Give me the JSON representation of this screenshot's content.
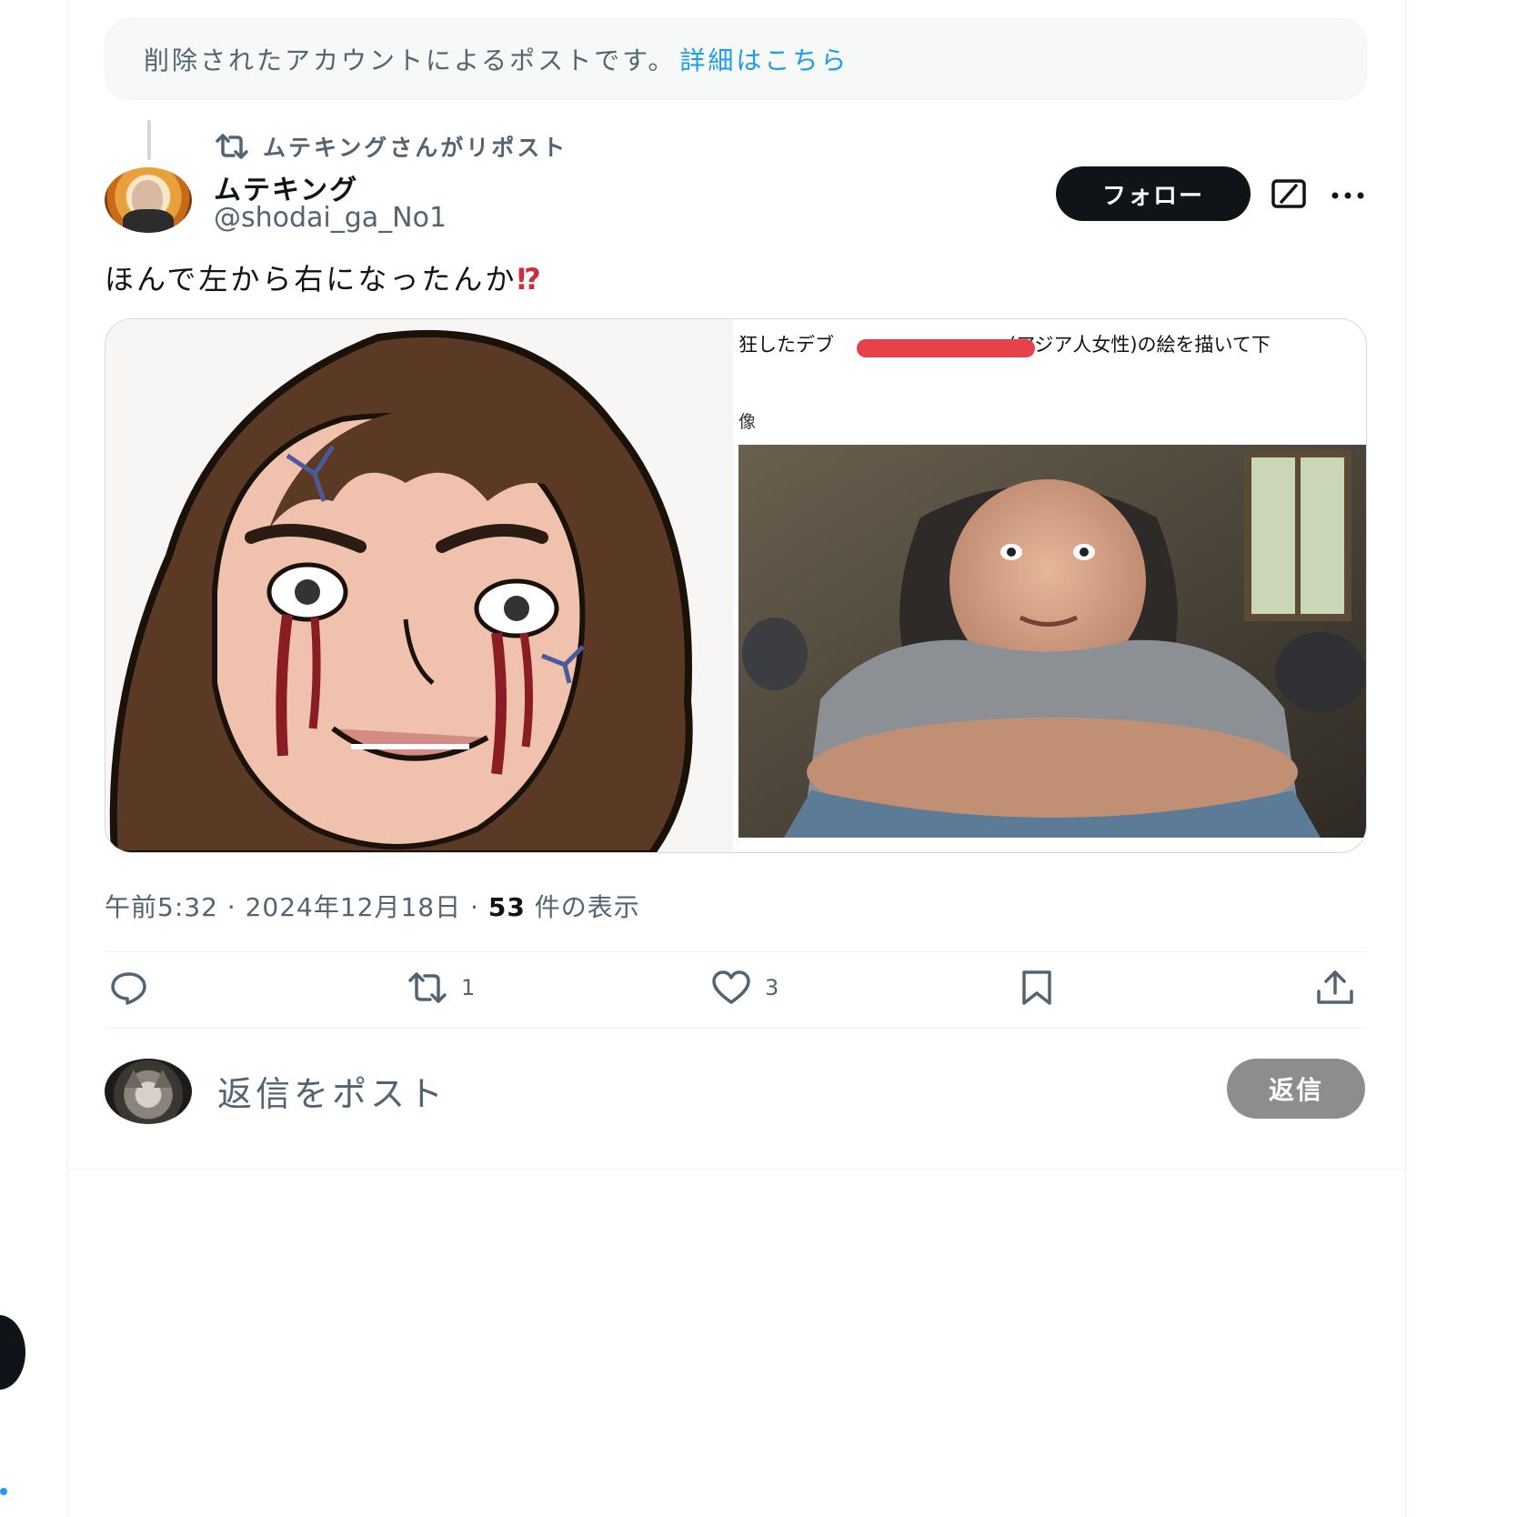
{
  "notice": {
    "text": "削除されたアカウントによるポストです。",
    "link": "詳細はこちら"
  },
  "repost": {
    "icon": "repost-icon",
    "label": "ムテキングさんがリポスト"
  },
  "author": {
    "name": "ムテキング",
    "handle": "@shodai_ga_No1"
  },
  "header_buttons": {
    "follow": "フォロー",
    "grok_icon": "grok-icon",
    "more_icon": "more-icon"
  },
  "post": {
    "text": "ほんで左から右になったんか",
    "emoji": "⁉"
  },
  "media": {
    "left_image": "illustration",
    "right_caption_start": "狂したデブ",
    "right_caption_end": "(アジア人女性)の絵を描いて下",
    "right_caption2": "像",
    "right_image": "photo"
  },
  "meta": {
    "time": "午前5:32",
    "date": "2024年12月18日",
    "views": "53",
    "views_label": "件の表示"
  },
  "actions": {
    "reply_count": "",
    "repost_count": "1",
    "like_count": "3"
  },
  "reply": {
    "placeholder": "返信をポスト",
    "button": "返信"
  },
  "colors": {
    "accent": "#1d9bf0",
    "text": "#0f1419",
    "secondary": "#536471",
    "redaction": "#e8414c"
  }
}
